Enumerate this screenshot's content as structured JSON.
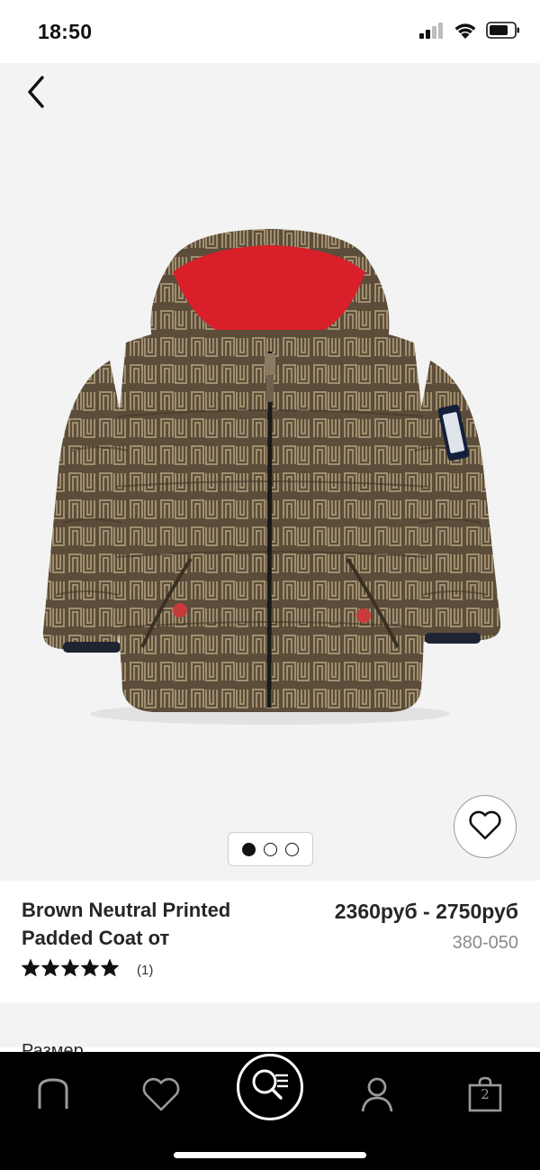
{
  "status_bar": {
    "time": "18:50",
    "icons": [
      "cellular-signal-icon",
      "wifi-icon",
      "battery-icon"
    ]
  },
  "navigation": {
    "back_icon": "chevron-left-icon"
  },
  "gallery": {
    "image_description": "brown-neutral-printed-padded-coat",
    "total_images": 3,
    "active_index": 0
  },
  "product": {
    "title": "Brown Neutral Printed Padded Coat от",
    "price": "2360руб - 2750руб",
    "code": "380-050",
    "rating": 5,
    "rating_max": 5,
    "review_count": "(1)"
  },
  "next_section_label": "Размер",
  "tab_bar": {
    "items": [
      {
        "name": "home",
        "icon": "next-logo-icon"
      },
      {
        "name": "favourites",
        "icon": "heart-icon"
      },
      {
        "name": "search",
        "icon": "search-list-icon"
      },
      {
        "name": "account",
        "icon": "person-icon"
      },
      {
        "name": "bag",
        "icon": "shopping-bag-icon",
        "badge": "2"
      }
    ]
  },
  "colors": {
    "coat_base": "#5b4d3a",
    "coat_pattern": "#a08e6e",
    "hood_lining": "#d81f2a",
    "tab_bar_bg": "#000000",
    "image_bg": "#f3f3f3"
  }
}
